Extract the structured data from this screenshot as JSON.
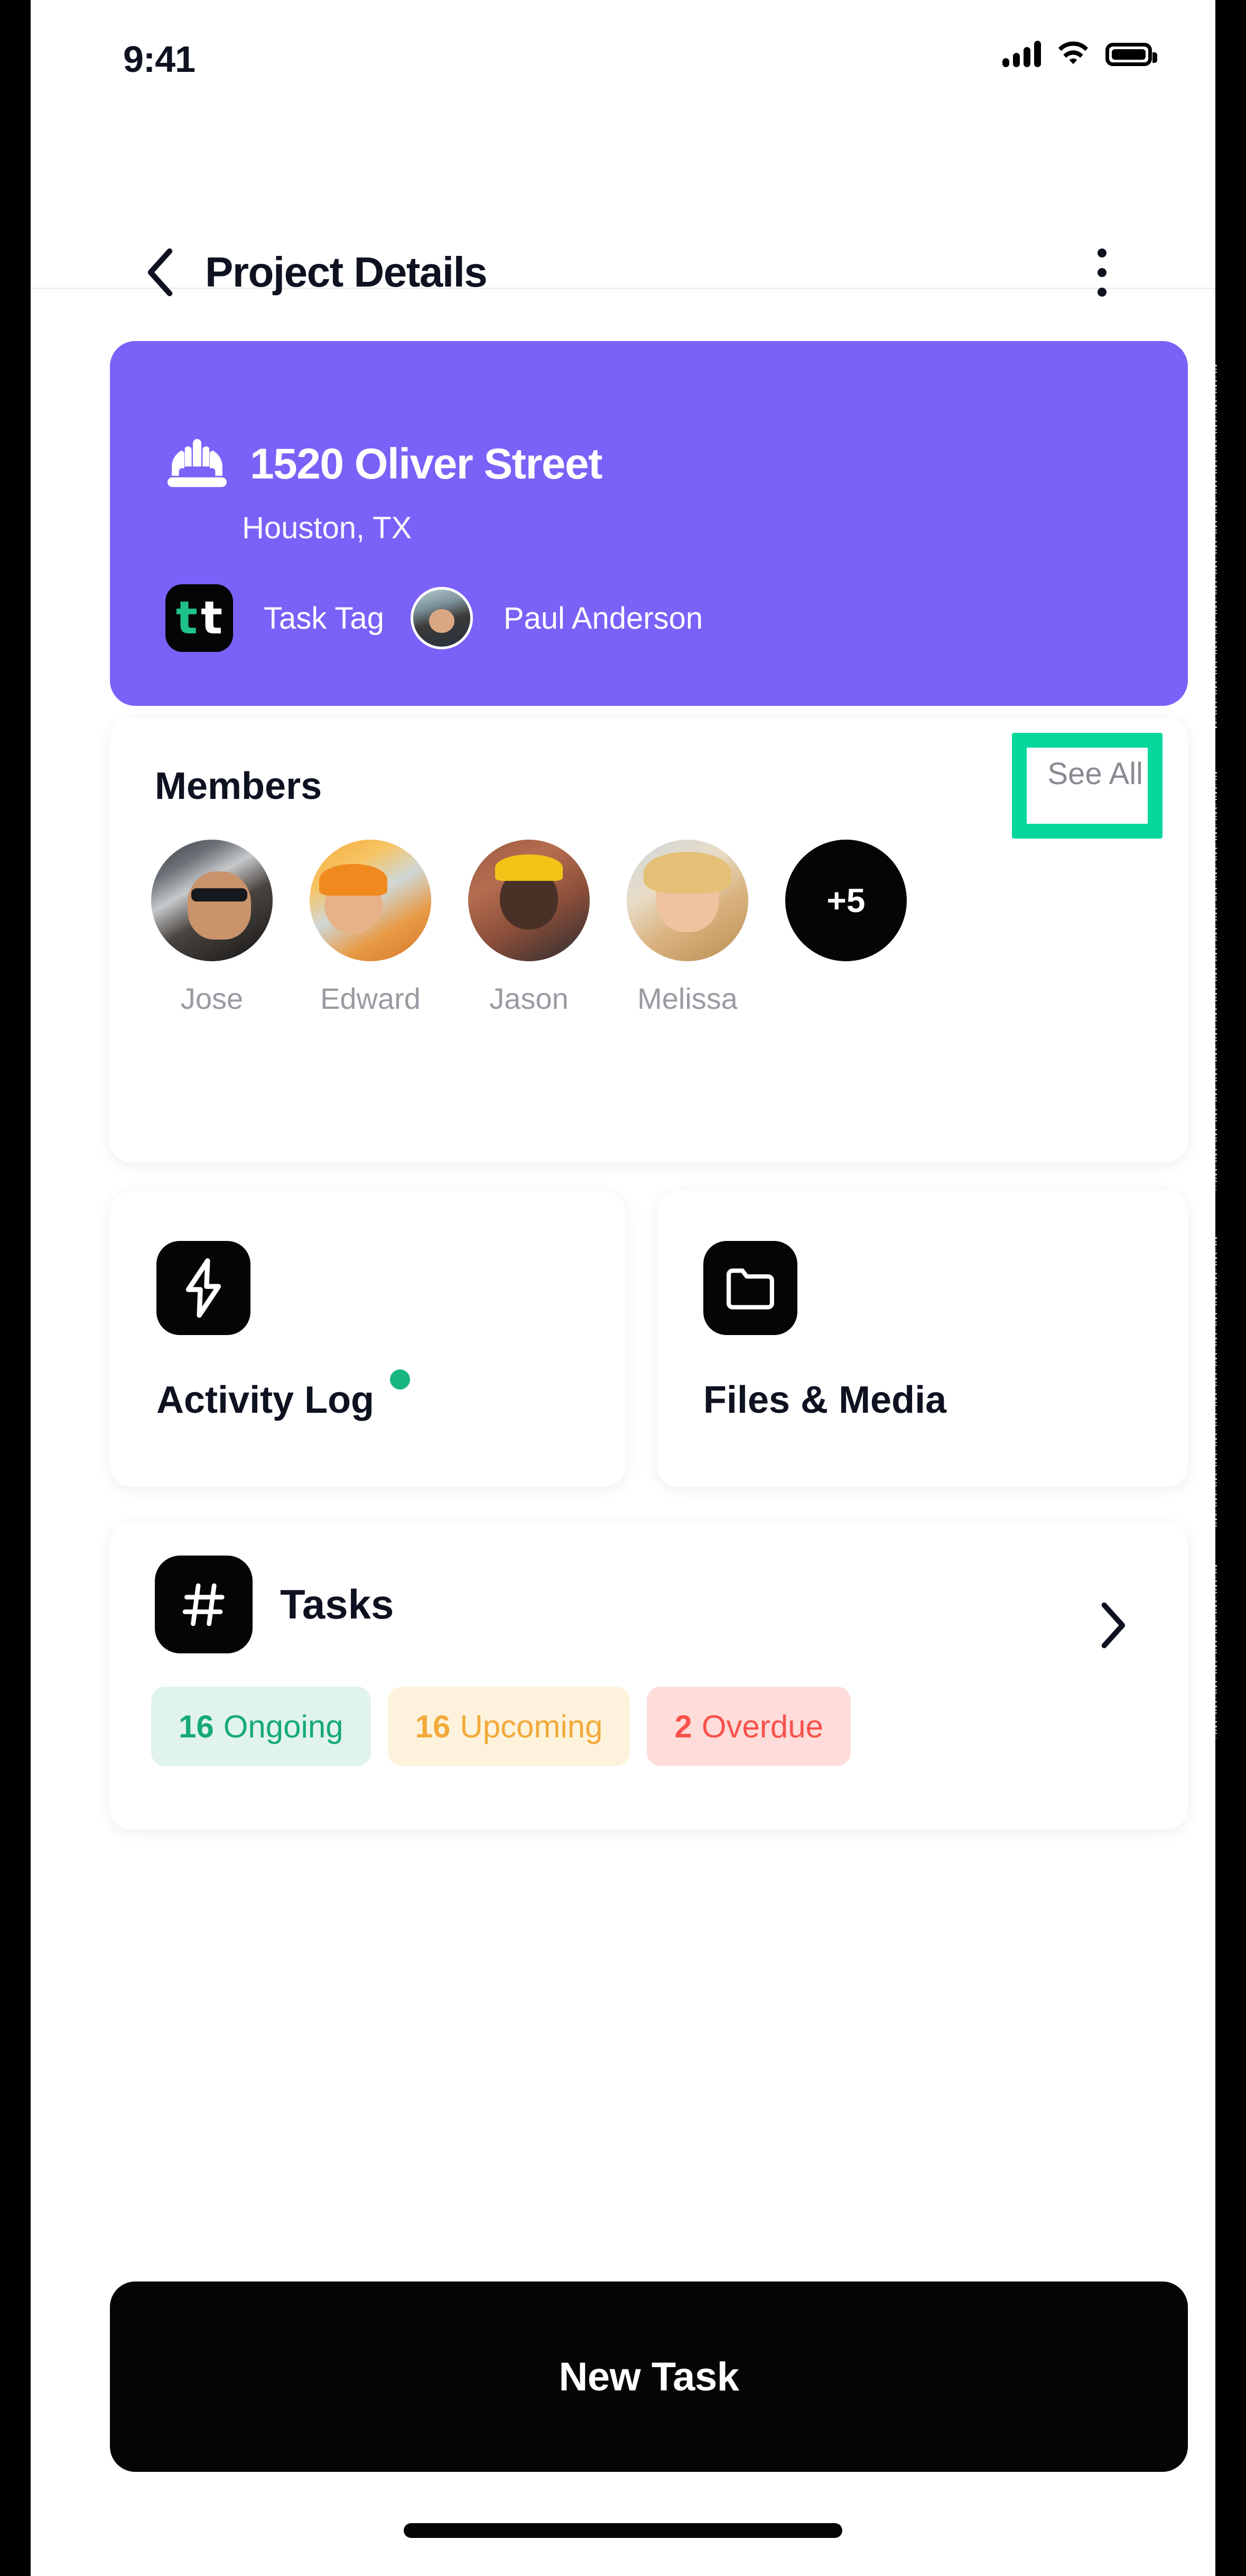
{
  "status_bar": {
    "time": "9:41",
    "signal_icon": "cellular-signal-icon",
    "wifi_icon": "wifi-icon",
    "battery_icon": "battery-full-icon"
  },
  "header": {
    "back_icon": "chevron-left-icon",
    "title": "Project Details",
    "menu_icon": "overflow-menu-icon"
  },
  "project": {
    "hardhat_icon": "hard-hat-icon",
    "name": "1520 Oliver Street",
    "city": "Houston, TX",
    "tag_logo": "task-tag-logo-icon",
    "tag_letter_left": "t",
    "tag_letter_right": "t",
    "tag_label": "Task Tag",
    "owner_avatar": "owner-avatar",
    "owner_name": "Paul Anderson",
    "accent_color": "#7B61F8"
  },
  "members": {
    "title": "Members",
    "see_all_label": "See All",
    "highlight_color": "#04D79C",
    "people": [
      {
        "name": "Jose"
      },
      {
        "name": "Edward"
      },
      {
        "name": "Jason"
      },
      {
        "name": "Melissa"
      }
    ],
    "overflow_label": "+5"
  },
  "shortcuts": {
    "activity": {
      "icon": "lightning-bolt-icon",
      "label": "Activity Log",
      "dot_color": "#19B57F",
      "has_notification_dot": true
    },
    "files": {
      "icon": "folder-icon",
      "label": "Files & Media"
    }
  },
  "tasks": {
    "icon": "hash-icon",
    "label": "Tasks",
    "chevron_icon": "chevron-right-icon",
    "chips": [
      {
        "count": "16",
        "label": "Ongoing",
        "text_color": "#16A97B",
        "bg_color": "#E0F3EC"
      },
      {
        "count": "16",
        "label": "Upcoming",
        "text_color": "#F2A93B",
        "bg_color": "#FDF3DC"
      },
      {
        "count": "2",
        "label": "Overdue",
        "text_color": "#F9524B",
        "bg_color": "#FDDCDA"
      }
    ]
  },
  "footer": {
    "primary_button_label": "New Task"
  }
}
